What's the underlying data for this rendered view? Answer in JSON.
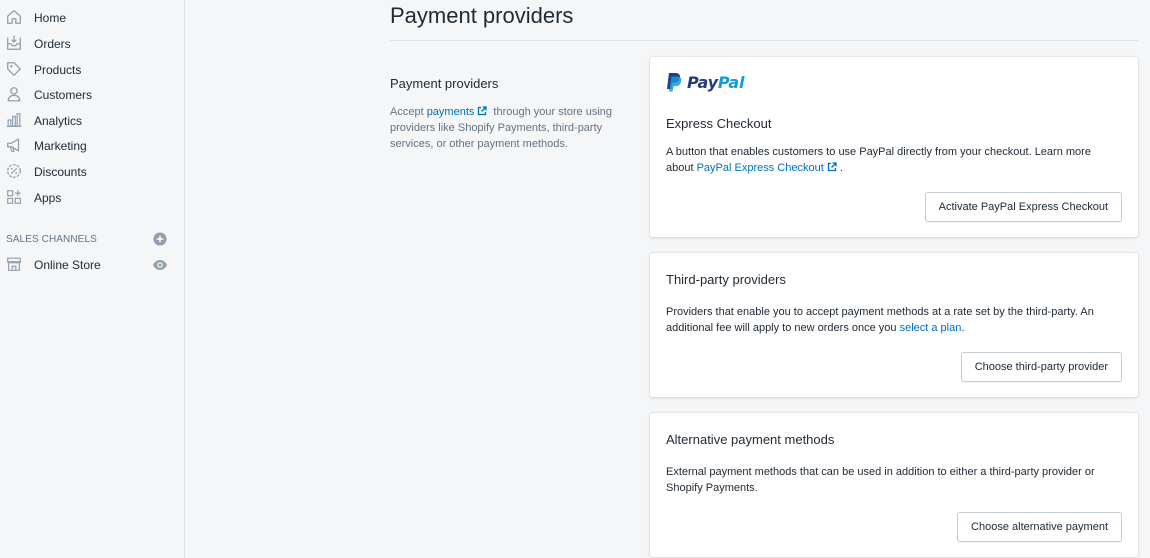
{
  "sidebar": {
    "items": [
      {
        "label": "Home",
        "icon": "home-icon"
      },
      {
        "label": "Orders",
        "icon": "orders-icon"
      },
      {
        "label": "Products",
        "icon": "tag-icon"
      },
      {
        "label": "Customers",
        "icon": "person-icon"
      },
      {
        "label": "Analytics",
        "icon": "bar-chart-icon"
      },
      {
        "label": "Marketing",
        "icon": "megaphone-icon"
      },
      {
        "label": "Discounts",
        "icon": "discount-icon"
      },
      {
        "label": "Apps",
        "icon": "apps-icon"
      }
    ],
    "sales_channels_title": "SALES CHANNELS",
    "channels": [
      {
        "label": "Online Store",
        "icon": "store-icon"
      }
    ]
  },
  "page": {
    "title": "Payment providers"
  },
  "section": {
    "heading": "Payment providers",
    "desc_before": "Accept ",
    "desc_link": "payments",
    "desc_after": "through your store using providers like Shopify Payments, third-party services, or other payment methods."
  },
  "cards": {
    "paypal": {
      "logo_text_1": "Pay",
      "logo_text_2": "Pal",
      "title": "Express Checkout",
      "text_before": "A button that enables customers to use PayPal directly from your checkout. Learn more about ",
      "text_link": "PayPal Express Checkout",
      "text_after": " .",
      "button": "Activate PayPal Express Checkout"
    },
    "third_party": {
      "title": "Third-party providers",
      "text_before": "Providers that enable you to accept payment methods at a rate set by the third-party. An additional fee will apply to new orders once you ",
      "text_link": "select a plan",
      "text_after": ".",
      "button": "Choose third-party provider"
    },
    "alternative": {
      "title": "Alternative payment methods",
      "text": "External payment methods that can be used in addition to either a third-party provider or Shopify Payments.",
      "button": "Choose alternative payment"
    }
  },
  "colors": {
    "link": "#006fbb",
    "paypal_dark": "#253b80",
    "paypal_light": "#179bd7",
    "icon_gray": "#919eab"
  }
}
